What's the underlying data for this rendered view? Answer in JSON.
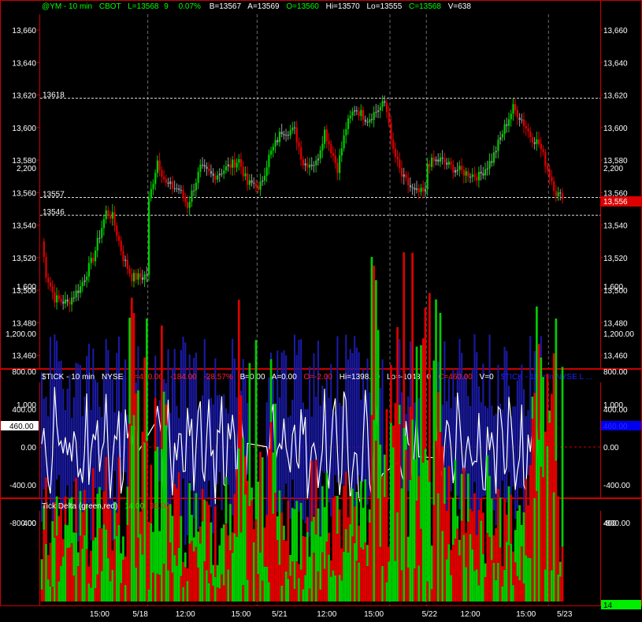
{
  "colors": {
    "background": "#000000",
    "panel_border": "#cc0000",
    "up_bar": "#00cc00",
    "down_bar": "#dd0000",
    "neutral_bar": "#9a9a9a",
    "tick_bar": "#1a1aa8",
    "tick_line": "#ffffff",
    "label_text": "#ffffff",
    "green_text": "#00ff00",
    "red_text": "#ff2020",
    "blue_text": "#2020ff"
  },
  "header": {
    "symbol": "@YM - 10 min",
    "exchange": "CBOT",
    "last": "L=13568",
    "change": "9",
    "pct": "0.07%",
    "bid": "B=13567",
    "ask": "A=13569",
    "open": "O=13560",
    "high": "Hi=13570",
    "low": "Lo=13555",
    "close": "C=13568",
    "volume": "V=638"
  },
  "tick_header": {
    "symbol": "$TICK - 10 min",
    "exchange": "NYSE",
    "last": "L=460.00",
    "change": "-184.00",
    "pct": "-28.57%",
    "bid": "B=0.00",
    "ask": "A=0.00",
    "open": "O=-2.00",
    "high": "Hi=1398.00",
    "low": "Lo=-1043.00",
    "close": "C=460.00",
    "volume": "V=0",
    "overlay": "$TICK - 10 min  NYSE  L ..."
  },
  "delta_header": {
    "title": "Tick Delta (green,red)",
    "green_value": "14.00",
    "red_value": "36.00"
  },
  "chart_data": [
    {
      "type": "bar",
      "style": "ohlc",
      "name_printed": "@YM - 10 min",
      "ylim": [
        13450,
        13670
      ],
      "yticks": [
        "13,660",
        "13,640",
        "13,620",
        "13,600",
        "13,580",
        "13,560",
        "13,540",
        "13,520",
        "13,500",
        "13,480",
        "13,460"
      ],
      "ytick_values": [
        13660,
        13640,
        13620,
        13600,
        13580,
        13560,
        13540,
        13520,
        13500,
        13480,
        13460
      ],
      "reference_lines": [
        {
          "label": "13618",
          "value": 13618
        },
        {
          "label": "13557",
          "value": 13557
        },
        {
          "label": "13546",
          "value": 13546
        }
      ],
      "last_price_label": "13,556",
      "last_price": 13556,
      "sessions": [
        {
          "label": "5/17",
          "printed": false
        },
        {
          "label": "5/18",
          "printed": true
        },
        {
          "label": "5/21",
          "printed": true
        },
        {
          "label": "5/22",
          "printed": true
        },
        {
          "label": "5/23",
          "printed": true
        }
      ],
      "x_tick_labels": [
        "15:00",
        "5/18",
        "12:00",
        "15:00",
        "5/21",
        "12:00",
        "15:00",
        "5/22",
        "12:00",
        "15:00",
        "5/23"
      ],
      "anchors": [
        [
          0,
          13530
        ],
        [
          2,
          13510
        ],
        [
          6,
          13495
        ],
        [
          12,
          13492
        ],
        [
          18,
          13502
        ],
        [
          24,
          13520
        ],
        [
          30,
          13548
        ],
        [
          33,
          13545
        ],
        [
          38,
          13520
        ],
        [
          42,
          13508
        ],
        [
          47,
          13508
        ],
        [
          49,
          13510
        ],
        [
          50,
          13555
        ],
        [
          54,
          13580
        ],
        [
          58,
          13565
        ],
        [
          64,
          13562
        ],
        [
          68,
          13552
        ],
        [
          74,
          13575
        ],
        [
          80,
          13570
        ],
        [
          86,
          13575
        ],
        [
          92,
          13580
        ],
        [
          96,
          13565
        ],
        [
          100,
          13566
        ],
        [
          101,
          13560
        ],
        [
          106,
          13582
        ],
        [
          112,
          13598
        ],
        [
          118,
          13598
        ],
        [
          122,
          13578
        ],
        [
          128,
          13578
        ],
        [
          132,
          13598
        ],
        [
          138,
          13575
        ],
        [
          142,
          13600
        ],
        [
          146,
          13612
        ],
        [
          152,
          13605
        ],
        [
          156,
          13610
        ],
        [
          160,
          13615
        ],
        [
          162,
          13605
        ],
        [
          163,
          13590
        ],
        [
          168,
          13570
        ],
        [
          174,
          13560
        ],
        [
          179,
          13560
        ],
        [
          180,
          13578
        ],
        [
          186,
          13580
        ],
        [
          192,
          13575
        ],
        [
          198,
          13572
        ],
        [
          204,
          13570
        ],
        [
          210,
          13580
        ],
        [
          216,
          13600
        ],
        [
          220,
          13612
        ],
        [
          224,
          13605
        ],
        [
          228,
          13595
        ],
        [
          232,
          13590
        ],
        [
          236,
          13575
        ],
        [
          240,
          13560
        ],
        [
          243,
          13556
        ]
      ],
      "tick_series": {
        "type": "bar",
        "ylim": [
          -1050,
          1400
        ],
        "yticks": [
          "1,200.00",
          "800.00",
          "400.00",
          "0.00",
          "-400.00",
          "-800.00"
        ],
        "ytick_values": [
          1200,
          800,
          400,
          0,
          -400,
          -800
        ],
        "last_label": "460.00",
        "last_value": 460
      },
      "delta_series": {
        "type": "bar",
        "ylim": [
          0,
          2500
        ],
        "yticks": [
          "2,200",
          "1,600",
          "1,000",
          "400"
        ],
        "ytick_values": [
          2200,
          1600,
          1000,
          400
        ],
        "last_label": "14"
      }
    }
  ]
}
